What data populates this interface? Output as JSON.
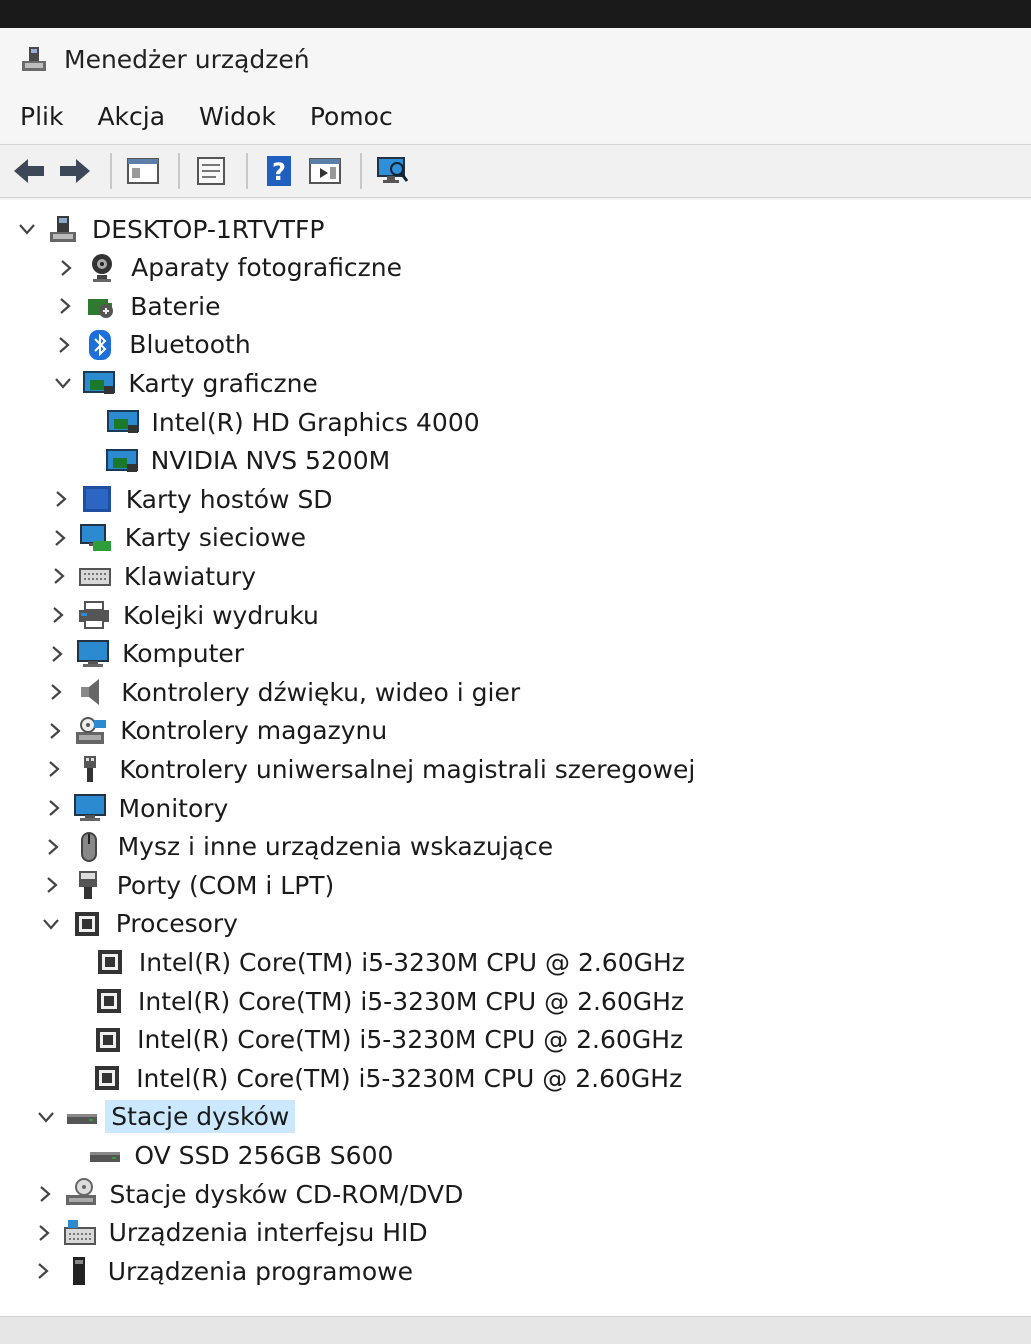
{
  "window": {
    "title": "Menedżer urządzeń"
  },
  "menu": [
    "Plik",
    "Akcja",
    "Widok",
    "Pomoc"
  ],
  "toolbar": [
    "back-icon",
    "forward-icon",
    "properties-view-icon",
    "update-driver-icon",
    "help-icon",
    "action-pane-icon",
    "scan-hardware-icon"
  ],
  "tree": {
    "root": "DESKTOP-1RTVTFP",
    "items": [
      {
        "label": "Aparaty fotograficzne",
        "icon": "camera-icon",
        "expanded": false,
        "level": 1
      },
      {
        "label": "Baterie",
        "icon": "battery-icon",
        "expanded": false,
        "level": 1
      },
      {
        "label": "Bluetooth",
        "icon": "bluetooth-icon",
        "expanded": false,
        "level": 1
      },
      {
        "label": "Karty graficzne",
        "icon": "display-adapter-icon",
        "expanded": true,
        "level": 1
      },
      {
        "label": "Intel(R) HD Graphics 4000",
        "icon": "display-adapter-icon",
        "level": 2
      },
      {
        "label": "NVIDIA NVS 5200M",
        "icon": "display-adapter-icon",
        "level": 2
      },
      {
        "label": "Karty hostów SD",
        "icon": "sd-host-icon",
        "expanded": false,
        "level": 1
      },
      {
        "label": "Karty sieciowe",
        "icon": "network-adapter-icon",
        "expanded": false,
        "level": 1
      },
      {
        "label": "Klawiatury",
        "icon": "keyboard-icon",
        "expanded": false,
        "level": 1
      },
      {
        "label": "Kolejki wydruku",
        "icon": "printer-icon",
        "expanded": false,
        "level": 1
      },
      {
        "label": "Komputer",
        "icon": "computer-icon",
        "expanded": false,
        "level": 1
      },
      {
        "label": "Kontrolery dźwięku, wideo i gier",
        "icon": "speaker-icon",
        "expanded": false,
        "level": 1
      },
      {
        "label": "Kontrolery magazynu",
        "icon": "storage-controller-icon",
        "expanded": false,
        "level": 1
      },
      {
        "label": "Kontrolery uniwersalnej magistrali szeregowej",
        "icon": "usb-icon",
        "expanded": false,
        "level": 1
      },
      {
        "label": "Monitory",
        "icon": "monitor-icon",
        "expanded": false,
        "level": 1
      },
      {
        "label": "Mysz i inne urządzenia wskazujące",
        "icon": "mouse-icon",
        "expanded": false,
        "level": 1
      },
      {
        "label": "Porty (COM i LPT)",
        "icon": "port-icon",
        "expanded": false,
        "level": 1
      },
      {
        "label": "Procesory",
        "icon": "processor-icon",
        "expanded": true,
        "level": 1
      },
      {
        "label": "Intel(R) Core(TM) i5-3230M CPU @ 2.60GHz",
        "icon": "processor-icon",
        "level": 2
      },
      {
        "label": "Intel(R) Core(TM) i5-3230M CPU @ 2.60GHz",
        "icon": "processor-icon",
        "level": 2
      },
      {
        "label": "Intel(R) Core(TM) i5-3230M CPU @ 2.60GHz",
        "icon": "processor-icon",
        "level": 2
      },
      {
        "label": "Intel(R) Core(TM) i5-3230M CPU @ 2.60GHz",
        "icon": "processor-icon",
        "level": 2
      },
      {
        "label": "Stacje dysków",
        "icon": "disk-drive-icon",
        "expanded": true,
        "selected": true,
        "level": 1
      },
      {
        "label": "OV SSD 256GB S600",
        "icon": "disk-drive-icon",
        "level": 2
      },
      {
        "label": "Stacje dysków CD-ROM/DVD",
        "icon": "cdrom-icon",
        "expanded": false,
        "level": 1
      },
      {
        "label": "Urządzenia interfejsu HID",
        "icon": "hid-icon",
        "expanded": false,
        "level": 1
      },
      {
        "label": "Urządzenia programowe",
        "icon": "software-device-icon",
        "expanded": false,
        "level": 1
      }
    ]
  }
}
